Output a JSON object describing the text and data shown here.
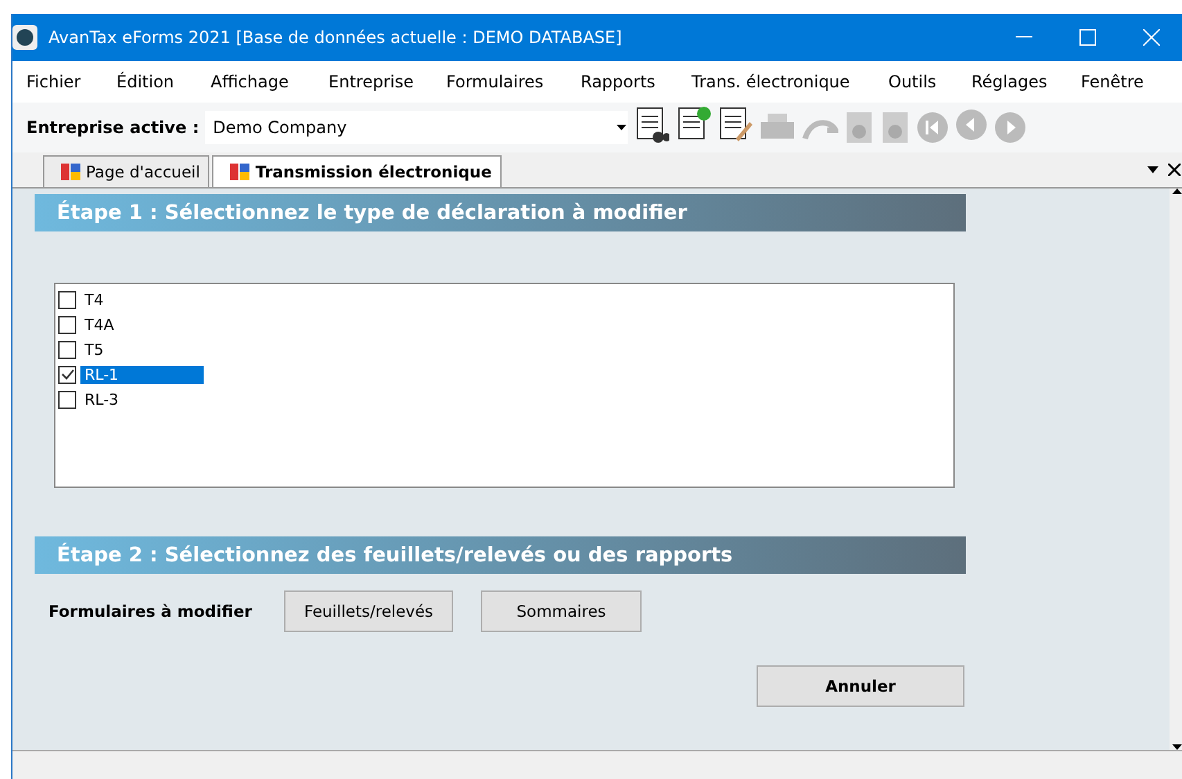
{
  "window": {
    "title": "AvanTax eForms 2021 [Base de données actuelle : DEMO DATABASE]"
  },
  "menu": [
    "Fichier",
    "Édition",
    "Affichage",
    "Entreprise",
    "Formulaires",
    "Rapports",
    "Trans. électronique",
    "Outils",
    "Réglages",
    "Fenêtre"
  ],
  "toolbar": {
    "label": "Entreprise active :",
    "company": "Demo Company"
  },
  "tabs": [
    {
      "label": "Page d'accueil",
      "selected": false
    },
    {
      "label": "Transmission électronique",
      "selected": true
    }
  ],
  "step1": {
    "title": "Étape 1 : Sélectionnez le type de déclaration à modifier",
    "items": [
      {
        "label": "T4",
        "checked": false,
        "selected": false
      },
      {
        "label": "T4A",
        "checked": false,
        "selected": false
      },
      {
        "label": "T5",
        "checked": false,
        "selected": false
      },
      {
        "label": "RL-1",
        "checked": true,
        "selected": true
      },
      {
        "label": "RL-3",
        "checked": false,
        "selected": false
      }
    ]
  },
  "step2": {
    "title": "Étape 2 : Sélectionnez des feuillets/relevés ou des rapports",
    "label": "Formulaires à modifier",
    "buttons": [
      "Feuillets/relevés",
      "Sommaires"
    ]
  },
  "cancel": "Annuler"
}
